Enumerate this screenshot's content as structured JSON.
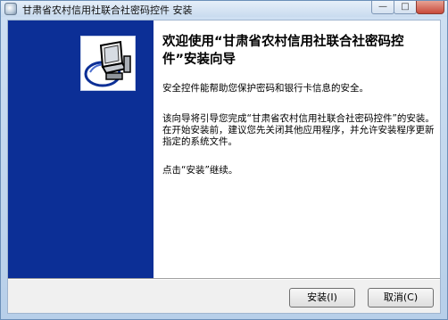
{
  "window": {
    "title": "甘肃省农村信用社联合社密码控件 安装",
    "controls": {
      "minimize": "—",
      "maximize": "□",
      "close": "✕"
    }
  },
  "wizard": {
    "heading": "欢迎使用“甘肃省农村信用社联合社密码控件”安装向导",
    "paragraphs": [
      "安全控件能帮助您保护密码和银行卡信息的安全。",
      "该向导将引导您完成“甘肃省农村信用社联合社密码控件”的安装。在开始安装前，建议您先关闭其他应用程序，并允许安装程序更新指定的系统文件。",
      "点击“安装”继续。"
    ],
    "sidebar_icon": "computer-installer-icon"
  },
  "buttons": {
    "install": "安装(I)",
    "cancel": "取消(C)"
  },
  "colors": {
    "sidebar": "#0c2f96",
    "panel": "#ffffff",
    "chrome": "#b9d1ea"
  }
}
